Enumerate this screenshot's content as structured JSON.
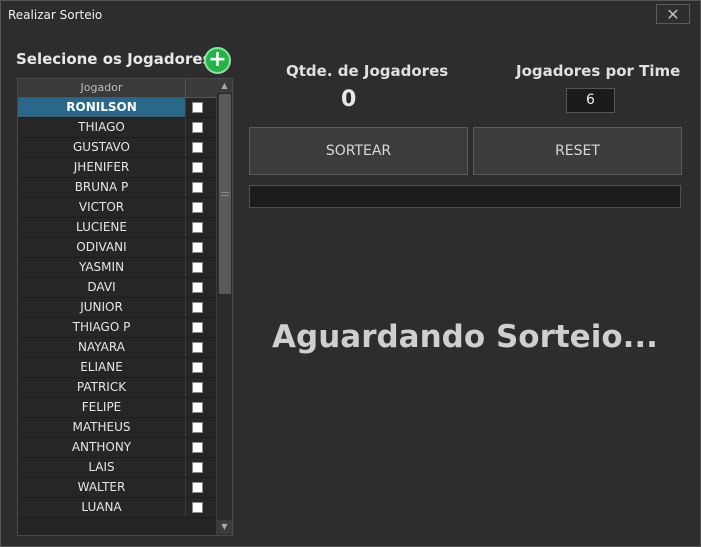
{
  "window": {
    "title": "Realizar Sorteio",
    "close_glyph": "✕"
  },
  "players_panel": {
    "title": "Selecione os Jogadores",
    "add_glyph": "+",
    "column_header": "Jogador",
    "selected_row": 0,
    "players": [
      {
        "name": "RONILSON",
        "checked": false
      },
      {
        "name": "THIAGO",
        "checked": false
      },
      {
        "name": "GUSTAVO",
        "checked": false
      },
      {
        "name": "JHENIFER",
        "checked": false
      },
      {
        "name": "BRUNA P",
        "checked": false
      },
      {
        "name": "VICTOR",
        "checked": false
      },
      {
        "name": "LUCIENE",
        "checked": false
      },
      {
        "name": "ODIVANI",
        "checked": false
      },
      {
        "name": "YASMIN",
        "checked": false
      },
      {
        "name": "DAVI",
        "checked": false
      },
      {
        "name": "JUNIOR",
        "checked": false
      },
      {
        "name": "THIAGO P",
        "checked": false
      },
      {
        "name": "NAYARA",
        "checked": false
      },
      {
        "name": "ELIANE",
        "checked": false
      },
      {
        "name": "PATRICK",
        "checked": false
      },
      {
        "name": "FELIPE",
        "checked": false
      },
      {
        "name": "MATHEUS",
        "checked": false
      },
      {
        "name": "ANTHONY",
        "checked": false
      },
      {
        "name": "LAIS",
        "checked": false
      },
      {
        "name": "WALTER",
        "checked": false
      },
      {
        "name": "LUANA",
        "checked": false
      }
    ]
  },
  "stats": {
    "count_label": "Qtde. de Jogadores",
    "count_value": "0",
    "per_team_label": "Jogadores por Time",
    "per_team_value": "6"
  },
  "actions": {
    "draw_label": "SORTEAR",
    "reset_label": "RESET"
  },
  "progress": {
    "value": 0
  },
  "status": {
    "text": "Aguardando Sorteio..."
  },
  "colors": {
    "accent": "#2a6788",
    "add_button": "#25b44a",
    "background": "#2d2d2d"
  }
}
